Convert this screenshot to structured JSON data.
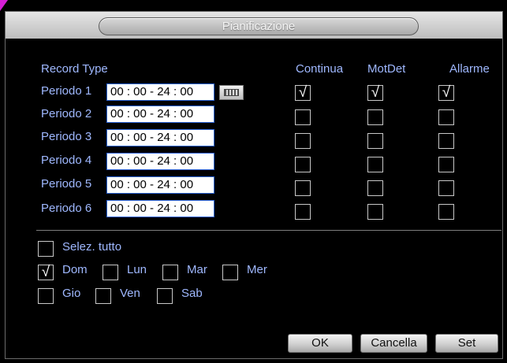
{
  "window": {
    "title": "Pianificazione"
  },
  "record_type_label": "Record Type",
  "columns": [
    "Continua",
    "MotDet",
    "Allarme"
  ],
  "periods": [
    {
      "label": "Periodo 1",
      "time": "00 : 00 - 24 : 00",
      "continua": "√",
      "motdet": "√",
      "allarme": "√"
    },
    {
      "label": "Periodo 2",
      "time": "00 : 00 - 24 : 00",
      "continua": "",
      "motdet": "",
      "allarme": ""
    },
    {
      "label": "Periodo 3",
      "time": "00 : 00 - 24 : 00",
      "continua": "",
      "motdet": "",
      "allarme": ""
    },
    {
      "label": "Periodo 4",
      "time": "00 : 00 - 24 : 00",
      "continua": "",
      "motdet": "",
      "allarme": ""
    },
    {
      "label": "Periodo 5",
      "time": "00 : 00 - 24 : 00",
      "continua": "",
      "motdet": "",
      "allarme": ""
    },
    {
      "label": "Periodo 6",
      "time": "00 : 00 - 24 : 00",
      "continua": "",
      "motdet": "",
      "allarme": ""
    }
  ],
  "select_all": {
    "label": "Selez. tutto",
    "mark": ""
  },
  "weekdays": [
    {
      "label": "Dom",
      "mark": "√"
    },
    {
      "label": "Lun",
      "mark": ""
    },
    {
      "label": "Mar",
      "mark": ""
    },
    {
      "label": "Mer",
      "mark": ""
    },
    {
      "label": "Gio",
      "mark": ""
    },
    {
      "label": "Ven",
      "mark": ""
    },
    {
      "label": "Sab",
      "mark": ""
    }
  ],
  "buttons": {
    "ok": "OK",
    "cancel": "Cancella",
    "set": "Set"
  },
  "icons": {
    "keyboard": "keyboard-icon"
  },
  "colors": {
    "label": "#9fb8ff",
    "field_border": "#2a62d6",
    "corner": "#d61fd6"
  }
}
